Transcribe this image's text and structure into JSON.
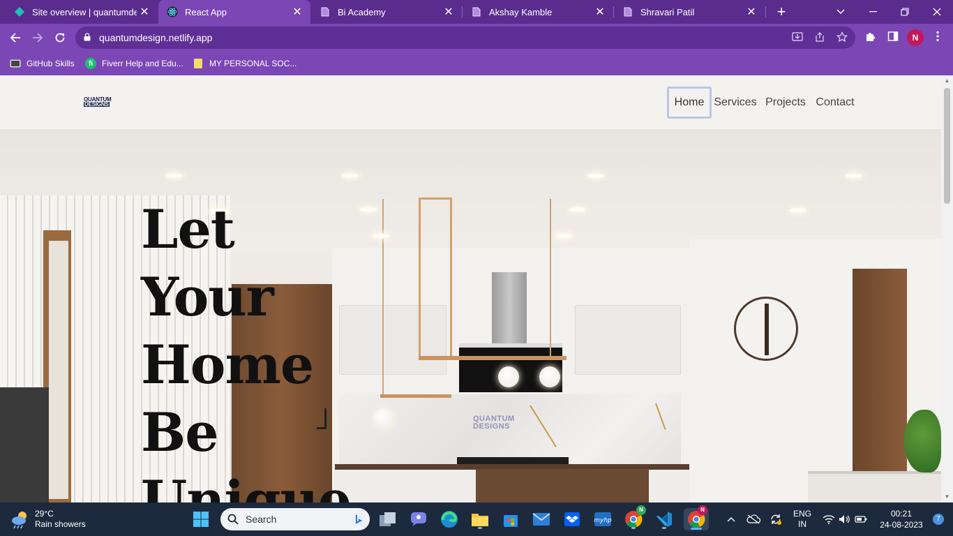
{
  "browser": {
    "tabs": [
      {
        "title": "Site overview | quantumdesign",
        "favicon": "netlify-icon",
        "active": false
      },
      {
        "title": "React App",
        "favicon": "react-icon",
        "active": true
      },
      {
        "title": "Bi Academy",
        "favicon": "page-icon",
        "active": false
      },
      {
        "title": "Akshay Kamble",
        "favicon": "page-icon",
        "active": false
      },
      {
        "title": "Shravari Patil",
        "favicon": "page-icon",
        "active": false
      }
    ],
    "tab_close_glyph": "✕",
    "new_tab_glyph": "+",
    "url": "quantumdesign.netlify.app",
    "profile_initial": "N",
    "bookmarks": [
      {
        "label": "GitHub Skills",
        "icon": "github-icon"
      },
      {
        "label": "Fiverr Help and Edu...",
        "icon": "fiverr-icon"
      },
      {
        "label": "MY PERSONAL SOC...",
        "icon": "folder-icon"
      }
    ],
    "colors": {
      "frame": "#5a2c8e",
      "toolbar": "#7a47b4",
      "omnibox": "#5e2f95"
    }
  },
  "site": {
    "logo": {
      "line1": "QUANTUM",
      "line2": "DESIGNS"
    },
    "nav": [
      {
        "label": "Home",
        "current": true
      },
      {
        "label": "Services",
        "current": false
      },
      {
        "label": "Projects",
        "current": false
      },
      {
        "label": "Contact",
        "current": false
      }
    ],
    "hero": {
      "heading_words": [
        "Let",
        "Your",
        "Home",
        "Be",
        "Unique"
      ],
      "watermark": {
        "line1": "QUANTUM",
        "line2": "DESIGNS"
      }
    },
    "scroll_position": 0.0
  },
  "taskbar": {
    "weather": {
      "temp": "29°C",
      "condition": "Rain showers"
    },
    "search_placeholder": "Search",
    "apps": [
      "windows-start-icon",
      "task-view-icon",
      "teams-chat-icon",
      "edge-icon",
      "file-explorer-icon",
      "microsoft-store-icon",
      "mail-icon",
      "dropbox-icon",
      "myhp-icon",
      "chrome-profile-icon",
      "vscode-icon",
      "chrome-icon"
    ],
    "app_badge": "N",
    "tray": {
      "lang_line1": "ENG",
      "lang_line2": "IN",
      "time": "00:21",
      "date": "24-08-2023",
      "notifications": "7"
    }
  }
}
